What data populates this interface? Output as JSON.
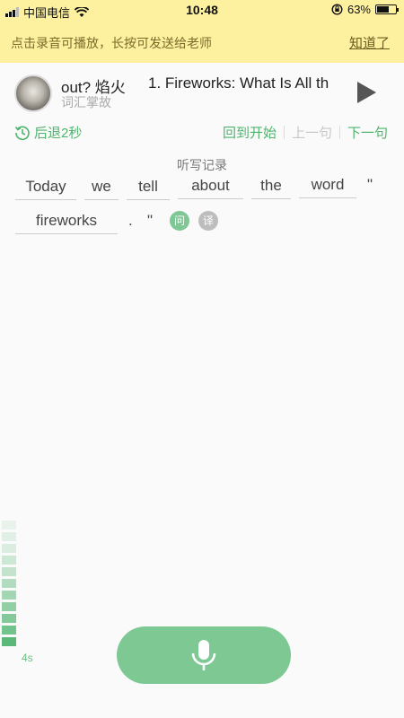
{
  "status_bar": {
    "carrier": "中国电信",
    "time": "10:48",
    "battery_text": "63%",
    "battery_level": 0.63,
    "icons": [
      "signal-icon",
      "wifi-icon",
      "orientation-lock-icon",
      "battery-icon"
    ]
  },
  "notice": {
    "text": "点击录音可播放，长按可发送给老师",
    "action_label": "知道了"
  },
  "lesson": {
    "title_fragment": "out? 焰火",
    "subtitle": "词汇掌故",
    "episode_title": "1. Fireworks: What Is All th",
    "play_icon": "play-icon"
  },
  "controls": {
    "rewind_label": "后退2秒",
    "restart_label": "回到开始",
    "prev_label": "上一句",
    "next_label": "下一句"
  },
  "dictation": {
    "heading": "听写记录",
    "words": [
      "Today",
      "we",
      "tell",
      "about",
      "the",
      "word",
      "\"",
      "fireworks",
      ".",
      "\""
    ],
    "question_badge": "问",
    "translate_badge": "译"
  },
  "recorder": {
    "duration_label": "4s",
    "mic_icon": "microphone-icon",
    "accent_color": "#7dc893"
  }
}
